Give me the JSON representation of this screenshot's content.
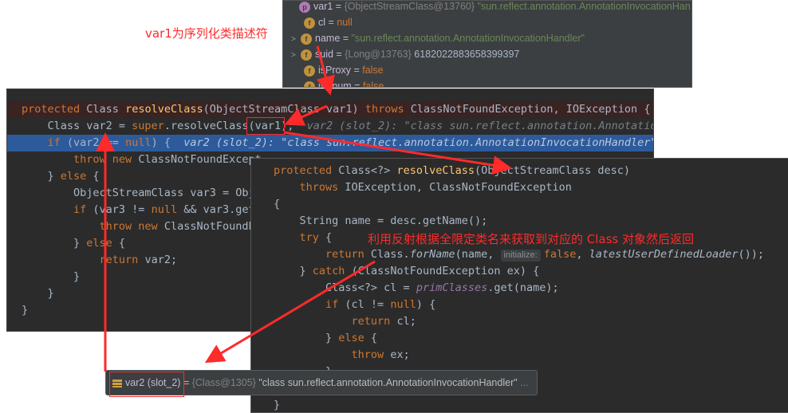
{
  "vars_popup": {
    "rows": [
      {
        "badge": "p",
        "name": "var1",
        "eq": " = ",
        "type": "{ObjectStreamClass@13760}",
        "value": " \"sun.reflect.annotation.AnnotationInvocationHan"
      },
      {
        "badge": "f",
        "name": "cl",
        "eq": " = ",
        "type": "",
        "value": "null"
      },
      {
        "badge": "f",
        "name": "name",
        "eq": " = ",
        "type": "",
        "value": "\"sun.reflect.annotation.AnnotationInvocationHandler\""
      },
      {
        "badge": "f",
        "name": "suid",
        "eq": " = ",
        "type": "{Long@13763}",
        "value": " 6182022883658399397"
      },
      {
        "badge": "f",
        "name": "isProxy",
        "eq": " = ",
        "type": "",
        "value": "false"
      },
      {
        "badge": "f",
        "name": "isEnum",
        "eq": " = ",
        "type": "",
        "value": "false"
      }
    ]
  },
  "main_code": {
    "l1": {
      "kw1": "protected ",
      "t1": "Class ",
      "fn": "resolveClass",
      "t2": "(ObjectStreamClass var1) ",
      "kw2": "throws ",
      "t3": "ClassNotFoundException, IOException {"
    },
    "l2": {
      "t1": "    Class var2 = ",
      "kw": "super",
      "t2": ".resolveClass(var1);",
      "hint": "  var2 (slot_2): \"class sun.reflect.annotation.Annotation"
    },
    "l3": {
      "kw": "    if ",
      "t1": "(var2 == ",
      "kw2": "null",
      "t2": ") {",
      "hint": "  var2 (slot_2): \"class sun.reflect.annotation.AnnotationInvocationHandler\""
    },
    "l4": {
      "kw": "        throw new ",
      "t1": "ClassNotFoundExcept"
    },
    "l5": {
      "t1": "    } ",
      "kw": "else ",
      "t2": "{"
    },
    "l6": {
      "t1": "        ObjectStreamClass var3 = Obj"
    },
    "l7": {
      "kw": "        if ",
      "t1": "(var3 != ",
      "kw2": "null ",
      "t2": "&& var3.get"
    },
    "l8": {
      "kw": "            throw new ",
      "t1": "ClassNotFoundE"
    },
    "l9": {
      "t1": "        } ",
      "kw": "else ",
      "t2": "{"
    },
    "l10": {
      "kw": "            return ",
      "t1": "var2;"
    },
    "l11": {
      "t1": "        }"
    },
    "l12": {
      "t1": "    }"
    },
    "l13": {
      "t1": "}"
    }
  },
  "overlay_code": {
    "l1": {
      "kw": "protected ",
      "t1": "Class<?> ",
      "fn": "resolveClass",
      "t2": "(ObjectStreamClass desc)"
    },
    "l2": {
      "kw": "    throws ",
      "t1": "IOException, ClassNotFoundException"
    },
    "l3": {
      "t1": "{"
    },
    "l4": {
      "t1": "    String name = desc.getName();"
    },
    "l5": {
      "kw": "    try ",
      "t1": "{"
    },
    "l6": {
      "kw": "        return ",
      "t1": "Class.",
      "it": "forName",
      "t2": "(name, ",
      "inlay": "initialize:",
      "kw2": "false",
      "t3": ", ",
      "it2": "latestUserDefinedLoader",
      "t4": "());"
    },
    "l7": {
      "t1": "    } ",
      "kw": "catch ",
      "t2": "(ClassNotFoundException ex) {"
    },
    "l8": {
      "t1": "        Class<?> cl = ",
      "purple": "primClasses",
      "t2": ".get(name);"
    },
    "l9": {
      "kw": "        if ",
      "t1": "(cl != ",
      "kw2": "null",
      "t2": ") {"
    },
    "l10": {
      "kw": "            return ",
      "t1": "cl;"
    },
    "l11": {
      "t1": "        } ",
      "kw": "else ",
      "t2": "{"
    },
    "l12": {
      "kw": "            throw ",
      "t1": "ex;"
    },
    "l13": {
      "t1": "        }"
    },
    "l14": {
      "t1": "    }"
    },
    "l15": {
      "t1": "}"
    }
  },
  "bottom_tooltip": {
    "name": "var2 (slot_2)",
    "eq": " = ",
    "type": "{Class@1305}",
    "value": " \"class sun.reflect.annotation.AnnotationInvocationHandler\"",
    "more": " ..."
  },
  "annotations": {
    "note1": "var1为序列化类描述符",
    "note2": "利用反射根据全限定类名来获取到对应的 Class 对象然后返回"
  },
  "colors": {
    "annotation": "#ff2a2a",
    "highlight_line": "#2d5a9b",
    "editor_bg": "#2b2b2b",
    "keyword": "#cc7832",
    "method": "#ffc66d"
  }
}
